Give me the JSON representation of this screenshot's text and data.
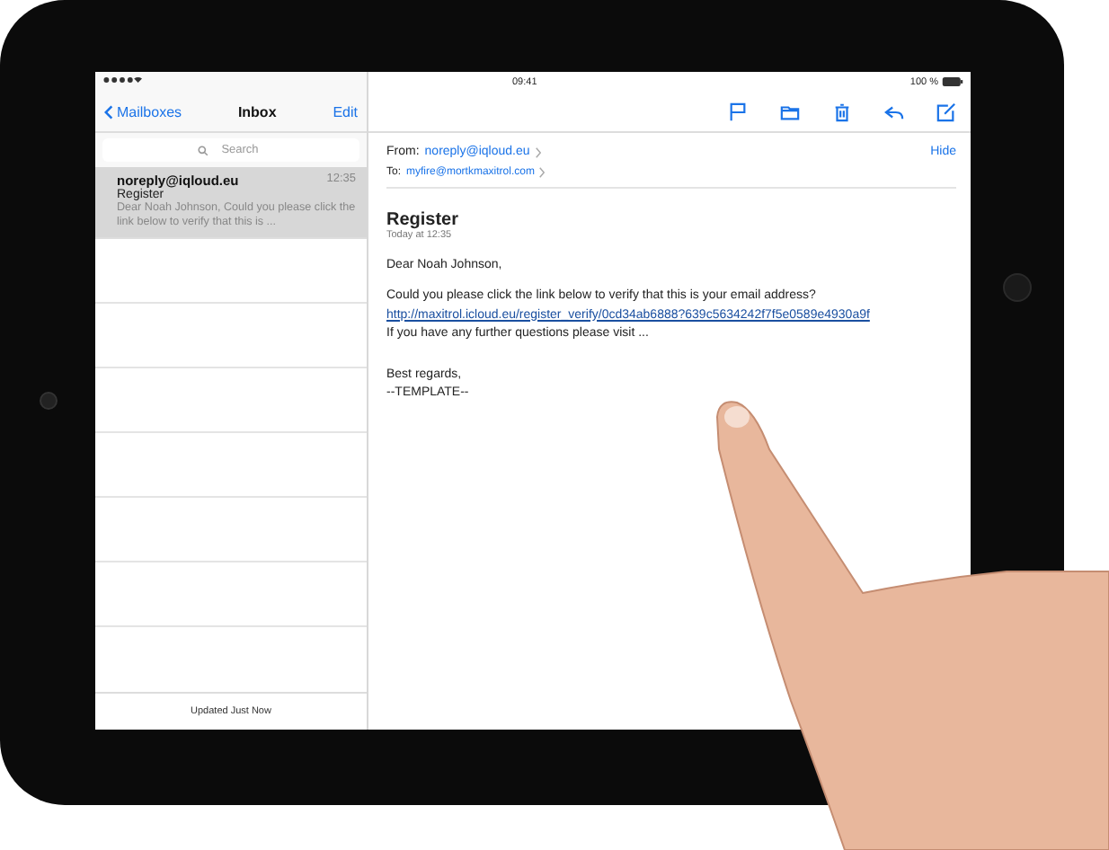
{
  "status_bar": {
    "time": "09:41",
    "battery": "100 %"
  },
  "sidebar": {
    "back_label": "Mailboxes",
    "title": "Inbox",
    "edit_label": "Edit",
    "search": {
      "placeholder": "Search"
    },
    "messages": [
      {
        "sender": "noreply@iqloud.eu",
        "time": "12:35",
        "subject": "Register",
        "preview": "Dear Noah Johnson, Could you please click the link below to verify that this is ...",
        "selected": true
      }
    ],
    "footer": "Updated Just Now"
  },
  "message": {
    "from_label": "From:",
    "from": "noreply@iqloud.eu",
    "to_label": "To:",
    "to": "myfire@mortkmaxitrol.com",
    "hide_label": "Hide",
    "subject": "Register",
    "date": "Today at 12:35",
    "greeting": "Dear Noah Johnson,",
    "request": "Could you please click the link below to verify that this is your email address?",
    "link": "http://maxitrol.icloud.eu/register_verify/0cd34ab6888?639c5634242f7f5e0589e4930a9f",
    "further": "If you have any further questions please visit ...",
    "closing": "Best regards,",
    "signature": "--TEMPLATE--"
  }
}
